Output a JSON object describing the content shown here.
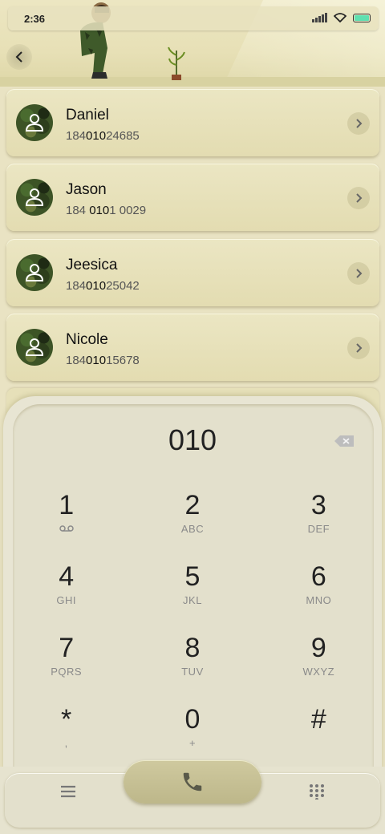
{
  "status_bar": {
    "time": "2:36"
  },
  "contacts": [
    {
      "name": "Daniel",
      "number_parts": [
        "184",
        "010",
        "24685"
      ]
    },
    {
      "name": "Jason",
      "number_parts": [
        "184 ",
        "010",
        "1 0029"
      ]
    },
    {
      "name": "Jeesica",
      "number_parts": [
        "184",
        "010",
        "25042"
      ]
    },
    {
      "name": "Nicole",
      "number_parts": [
        "184",
        "010",
        "15678"
      ]
    }
  ],
  "dialpad": {
    "entered": "010",
    "keys": [
      {
        "digit": "1",
        "letters": ""
      },
      {
        "digit": "2",
        "letters": "ABC"
      },
      {
        "digit": "3",
        "letters": "DEF"
      },
      {
        "digit": "4",
        "letters": "GHI"
      },
      {
        "digit": "5",
        "letters": "JKL"
      },
      {
        "digit": "6",
        "letters": "MNO"
      },
      {
        "digit": "7",
        "letters": "PQRS"
      },
      {
        "digit": "8",
        "letters": "TUV"
      },
      {
        "digit": "9",
        "letters": "WXYZ"
      },
      {
        "digit": "*",
        "letters": ","
      },
      {
        "digit": "0",
        "letters": "+"
      },
      {
        "digit": "#",
        "letters": ""
      }
    ]
  },
  "colors": {
    "background": "#e9e3c3",
    "card": "#e8e1b9",
    "call_button": "#c7c195",
    "battery": "#5fe0b0"
  },
  "icons": [
    "back-icon",
    "signal-icon",
    "wifi-icon",
    "battery-icon",
    "contact-avatar-icon",
    "chevron-right-icon",
    "backspace-icon",
    "voicemail-icon",
    "menu-icon",
    "phone-icon",
    "dialpad-grid-icon"
  ]
}
